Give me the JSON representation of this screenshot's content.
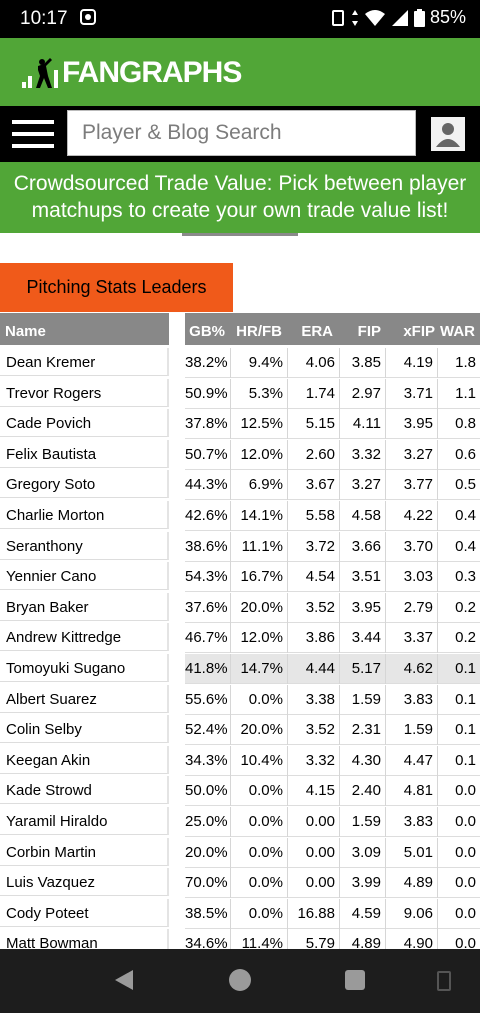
{
  "status": {
    "time": "10:17",
    "battery": "85%"
  },
  "header": {
    "logo_text": "FANGRAPHS"
  },
  "search": {
    "placeholder": "Player & Blog Search"
  },
  "banner": {
    "line1": "Crowdsourced Trade Value: Pick between player",
    "line2": "matchups to create your own trade value list!"
  },
  "section": {
    "tab_label": "Pitching Stats Leaders"
  },
  "table": {
    "columns": [
      "Name",
      "GB%",
      "HR/FB",
      "ERA",
      "FIP",
      "xFIP",
      "WAR"
    ],
    "rows": [
      [
        "Dean Kremer",
        "38.2%",
        "9.4%",
        "4.06",
        "3.85",
        "4.19",
        "1.8"
      ],
      [
        "Trevor Rogers",
        "50.9%",
        "5.3%",
        "1.74",
        "2.97",
        "3.71",
        "1.1"
      ],
      [
        "Cade Povich",
        "37.8%",
        "12.5%",
        "5.15",
        "4.11",
        "3.95",
        "0.8"
      ],
      [
        "Felix Bautista",
        "50.7%",
        "12.0%",
        "2.60",
        "3.32",
        "3.27",
        "0.6"
      ],
      [
        "Gregory Soto",
        "44.3%",
        "6.9%",
        "3.67",
        "3.27",
        "3.77",
        "0.5"
      ],
      [
        "Charlie Morton",
        "42.6%",
        "14.1%",
        "5.58",
        "4.58",
        "4.22",
        "0.4"
      ],
      [
        "Seranthony",
        "38.6%",
        "11.1%",
        "3.72",
        "3.66",
        "3.70",
        "0.4"
      ],
      [
        "Yennier Cano",
        "54.3%",
        "16.7%",
        "4.54",
        "3.51",
        "3.03",
        "0.3"
      ],
      [
        "Bryan Baker",
        "37.6%",
        "20.0%",
        "3.52",
        "3.95",
        "2.79",
        "0.2"
      ],
      [
        "Andrew Kittredge",
        "46.7%",
        "12.0%",
        "3.86",
        "3.44",
        "3.37",
        "0.2"
      ],
      [
        "Tomoyuki Sugano",
        "41.8%",
        "14.7%",
        "4.44",
        "5.17",
        "4.62",
        "0.1"
      ],
      [
        "Albert Suarez",
        "55.6%",
        "0.0%",
        "3.38",
        "1.59",
        "3.83",
        "0.1"
      ],
      [
        "Colin Selby",
        "52.4%",
        "20.0%",
        "3.52",
        "2.31",
        "1.59",
        "0.1"
      ],
      [
        "Keegan Akin",
        "34.3%",
        "10.4%",
        "3.32",
        "4.30",
        "4.47",
        "0.1"
      ],
      [
        "Kade Strowd",
        "50.0%",
        "0.0%",
        "4.15",
        "2.40",
        "4.81",
        "0.0"
      ],
      [
        "Yaramil Hiraldo",
        "25.0%",
        "0.0%",
        "0.00",
        "1.59",
        "3.83",
        "0.0"
      ],
      [
        "Corbin Martin",
        "20.0%",
        "0.0%",
        "0.00",
        "3.09",
        "5.01",
        "0.0"
      ],
      [
        "Luis Vazquez",
        "70.0%",
        "0.0%",
        "0.00",
        "3.99",
        "4.89",
        "0.0"
      ],
      [
        "Cody Poteet",
        "38.5%",
        "0.0%",
        "16.88",
        "4.59",
        "9.06",
        "0.0"
      ],
      [
        "Matt Bowman",
        "34.6%",
        "11.4%",
        "5.79",
        "4.89",
        "4.90",
        "0.0"
      ]
    ]
  }
}
